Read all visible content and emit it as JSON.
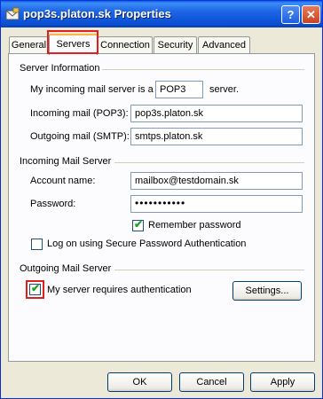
{
  "window": {
    "title": "pop3s.platon.sk Properties",
    "help_symbol": "?",
    "close_symbol": "✕"
  },
  "tabs": [
    {
      "label": "General"
    },
    {
      "label": "Servers"
    },
    {
      "label": "Connection"
    },
    {
      "label": "Security"
    },
    {
      "label": "Advanced"
    }
  ],
  "server_info": {
    "heading": "Server Information",
    "incoming_type_prefix": "My incoming mail server is a",
    "incoming_type_value": "POP3",
    "incoming_type_suffix": "server.",
    "incoming_label": "Incoming mail (POP3):",
    "incoming_value": "pop3s.platon.sk",
    "outgoing_label": "Outgoing mail (SMTP):",
    "outgoing_value": "smtps.platon.sk"
  },
  "incoming_server": {
    "heading": "Incoming Mail Server",
    "account_label": "Account name:",
    "account_value": "mailbox@testdomain.sk",
    "password_label": "Password:",
    "password_value": "•••••••••••",
    "remember_label": "Remember password",
    "remember_checked": true,
    "spa_label": "Log on using Secure Password Authentication",
    "spa_checked": false
  },
  "outgoing_server": {
    "heading": "Outgoing Mail Server",
    "auth_label": "My server requires authentication",
    "auth_checked": true,
    "settings_button": "Settings..."
  },
  "footer": {
    "ok": "OK",
    "cancel": "Cancel",
    "apply": "Apply"
  },
  "icons": {
    "app": "mail-icon",
    "check": "checkmark-icon"
  }
}
